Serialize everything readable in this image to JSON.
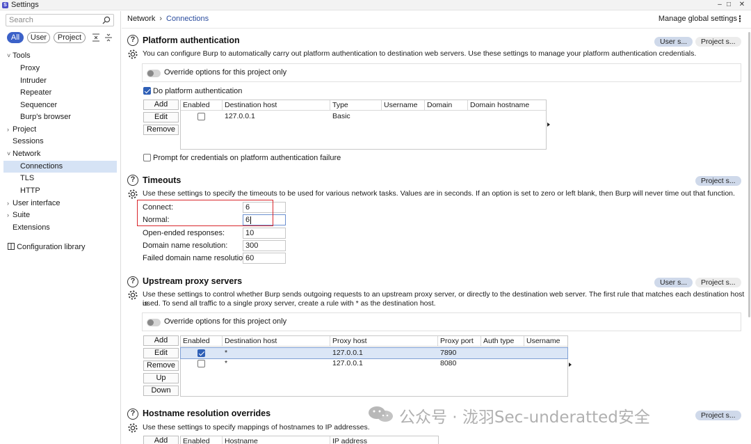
{
  "window": {
    "title": "Settings",
    "minimize": "–",
    "maximize": "□",
    "close": "✕"
  },
  "sidebar": {
    "search_placeholder": "Search",
    "filters": [
      "All",
      "User",
      "Project"
    ],
    "tree": {
      "tools": "Tools",
      "proxy": "Proxy",
      "intruder": "Intruder",
      "repeater": "Repeater",
      "sequencer": "Sequencer",
      "browser": "Burp's browser",
      "project": "Project",
      "sessions": "Sessions",
      "network": "Network",
      "connections": "Connections",
      "tls": "TLS",
      "http": "HTTP",
      "user_interface": "User interface",
      "suite": "Suite",
      "extensions": "Extensions"
    },
    "config_library": "Configuration library"
  },
  "header": {
    "breadcrumb": [
      "Network",
      "Connections"
    ],
    "manage_global": "Manage global settings"
  },
  "platform_auth": {
    "title": "Platform authentication",
    "description": "You can configure Burp to automatically carry out platform authentication to destination web servers. Use these settings to manage your platform authentication credentials.",
    "user_btn": "User s...",
    "project_btn": "Project s...",
    "override": "Override options for this project only",
    "do_auth": "Do platform authentication",
    "buttons": [
      "Add",
      "Edit",
      "Remove"
    ],
    "columns": [
      "Enabled",
      "Destination host",
      "Type",
      "Username",
      "Domain",
      "Domain hostname"
    ],
    "rows": [
      {
        "enabled": false,
        "host": "127.0.0.1",
        "type": "Basic",
        "username": "",
        "domain": "",
        "domain_hostname": ""
      }
    ],
    "prompt": "Prompt for credentials on platform authentication failure"
  },
  "timeouts": {
    "title": "Timeouts",
    "project_btn": "Project s...",
    "description": "Use these settings to specify the timeouts to be used for various network tasks. Values are in seconds. If an option is set to zero or left blank, then Burp will never time out that function.",
    "fields": [
      {
        "label": "Connect:",
        "value": "6"
      },
      {
        "label": "Normal:",
        "value": "6"
      },
      {
        "label": "Open-ended responses:",
        "value": "10"
      },
      {
        "label": "Domain name resolution:",
        "value": "300"
      },
      {
        "label": "Failed domain name resolution:",
        "value": "60"
      }
    ]
  },
  "upstream": {
    "title": "Upstream proxy servers",
    "user_btn": "User s...",
    "project_btn": "Project s...",
    "description_line1": "Use these settings to control whether Burp sends outgoing requests to an upstream proxy server, or directly to the destination web server. The first rule that matches each destination host is",
    "description_line2": "used. To send all traffic to a single proxy server, create a rule with * as the destination host.",
    "override": "Override options for this project only",
    "buttons": [
      "Add",
      "Edit",
      "Remove",
      "Up",
      "Down"
    ],
    "columns": [
      "Enabled",
      "Destination host",
      "Proxy host",
      "Proxy port",
      "Auth type",
      "Username"
    ],
    "rows": [
      {
        "enabled": true,
        "dest": "*",
        "proxy_host": "127.0.0.1",
        "proxy_port": "7890",
        "auth": "",
        "username": ""
      },
      {
        "enabled": false,
        "dest": "*",
        "proxy_host": "127.0.0.1",
        "proxy_port": "8080",
        "auth": "",
        "username": ""
      }
    ]
  },
  "hostname": {
    "title": "Hostname resolution overrides",
    "project_btn": "Project s...",
    "description": "Use these settings to specify mappings of hostnames to IP addresses.",
    "add_btn": "Add",
    "columns": [
      "Enabled",
      "Hostname",
      "IP address"
    ]
  },
  "watermark": "公众号 · 泷羽Sec-underatted安全"
}
